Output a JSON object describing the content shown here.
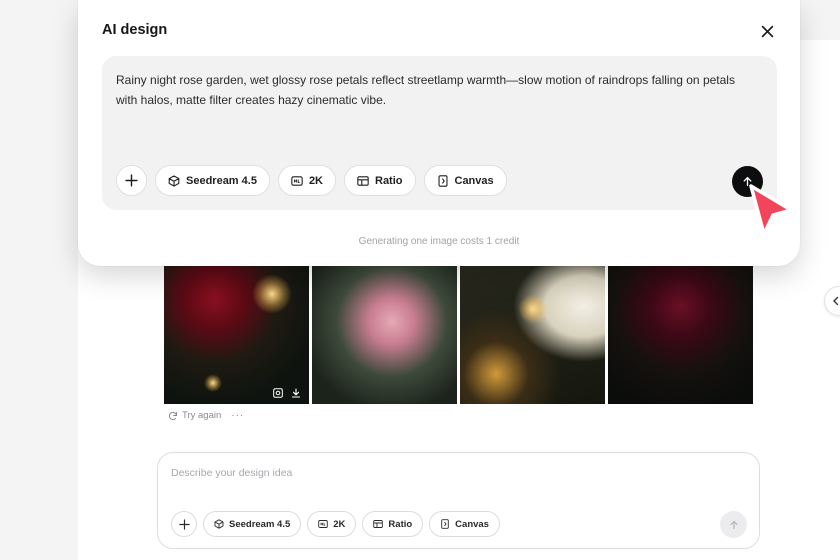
{
  "modal": {
    "title": "AI design",
    "prompt": "Rainy night rose garden, wet glossy rose petals reflect streetlamp warmth—slow motion of raindrops falling on petals with halos, matte filter creates hazy cinematic vibe.",
    "chips": [
      {
        "label": "Seedream 4.5",
        "icon": "cube-icon"
      },
      {
        "label": "2K",
        "icon": "resolution-icon"
      },
      {
        "label": "Ratio",
        "icon": "ratio-icon"
      },
      {
        "label": "Canvas",
        "icon": "canvas-icon"
      }
    ],
    "cost_note": "Generating one image costs 1 credit"
  },
  "results": {
    "images": [
      {
        "subject": "red rose with warm bokeh lights"
      },
      {
        "subject": "pink roses in rain"
      },
      {
        "subject": "white rose petal with water droplet"
      },
      {
        "subject": "dark red rose with raindrops"
      }
    ],
    "retry_label": "Try again",
    "more_label": "···"
  },
  "composer": {
    "placeholder": "Describe your design idea",
    "chips": [
      {
        "label": "Seedream 4.5",
        "icon": "cube-icon"
      },
      {
        "label": "2K",
        "icon": "resolution-icon"
      },
      {
        "label": "Ratio",
        "icon": "ratio-icon"
      },
      {
        "label": "Canvas",
        "icon": "canvas-icon"
      }
    ]
  },
  "colors": {
    "accent_cursor": "#f2445a",
    "send_active": "#0d0d0f",
    "send_disabled": "#ececee"
  }
}
